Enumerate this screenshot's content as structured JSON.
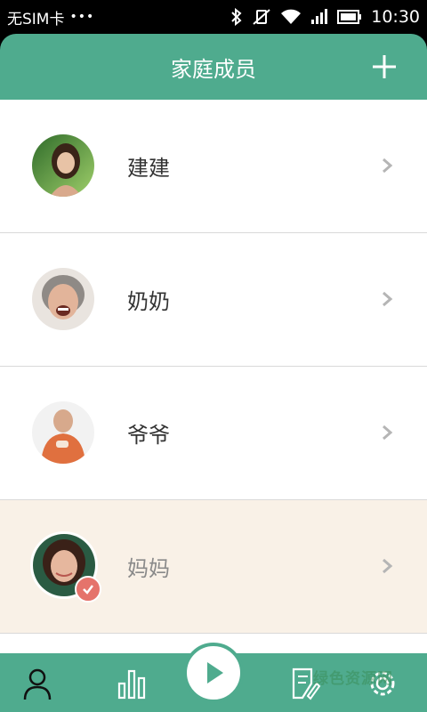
{
  "status_bar": {
    "carrier": "无SIM卡",
    "dots": "•••",
    "time": "10:30"
  },
  "header": {
    "title": "家庭成员"
  },
  "members": [
    {
      "name": "建建",
      "selected": false
    },
    {
      "name": "奶奶",
      "selected": false
    },
    {
      "name": "爷爷",
      "selected": false
    },
    {
      "name": "妈妈",
      "selected": true
    }
  ],
  "watermark": "绿色资源网",
  "colors": {
    "primary": "#4fab8e",
    "selected_row": "#f9f1e7",
    "badge": "#e5736b"
  }
}
